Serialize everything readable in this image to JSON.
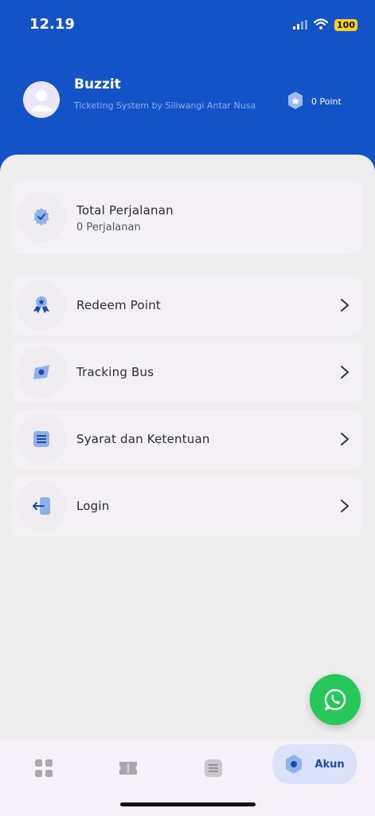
{
  "status_bar": {
    "time": "12.19",
    "battery": "100"
  },
  "profile": {
    "app_name": "Buzzit",
    "subtitle": "Ticketing System by Siliwangi Antar Nusa",
    "points": "0 Point"
  },
  "summary": {
    "title": "Total Perjalanan",
    "value": "0 Perjalanan"
  },
  "menu": [
    {
      "label": "Redeem Point",
      "icon": "award-icon"
    },
    {
      "label": "Tracking Bus",
      "icon": "compass-icon"
    },
    {
      "label": "Syarat dan Ketentuan",
      "icon": "document-list-icon"
    },
    {
      "label": "Login",
      "icon": "login-icon"
    }
  ],
  "bottom_nav": {
    "items": [
      {
        "icon": "grid-icon"
      },
      {
        "icon": "ticket-icon"
      },
      {
        "icon": "list-icon"
      },
      {
        "icon": "account-hexagon-icon",
        "label": "Akun",
        "active": true
      }
    ]
  },
  "colors": {
    "primary": "#1453c7",
    "accent": "#1b4aa8",
    "whatsapp": "#27c75a",
    "background": "#eeeeee",
    "card": "#f4f1f6"
  }
}
